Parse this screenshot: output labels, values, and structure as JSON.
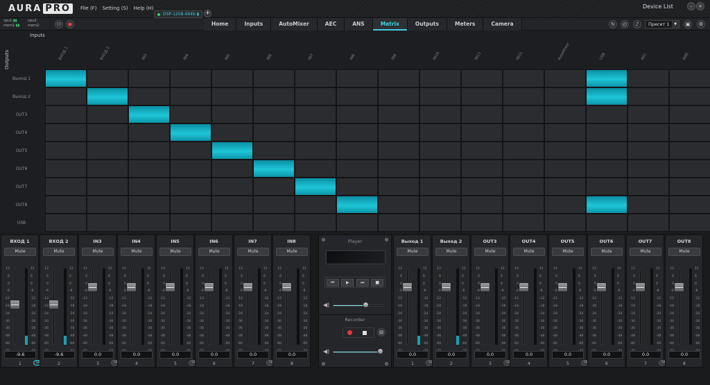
{
  "app": {
    "logo_main": "AURA",
    "logo_pro": "PRO",
    "menu": [
      "File (F)",
      "Setting (S)",
      "Help (H)"
    ],
    "device_list": "Device List"
  },
  "status": {
    "cpu1": "cpu1:",
    "mem1": "mem1:",
    "cpu2": "cpu2:",
    "mem2": "mem2:",
    "device_tab": "DSP-1208-464b"
  },
  "tabs": [
    "Home",
    "Inputs",
    "AutoMixer",
    "AEC",
    "ANS",
    "Matrix",
    "Outputs",
    "Meters",
    "Camera"
  ],
  "active_tab": "Matrix",
  "preset": "Пресет 1",
  "matrix": {
    "inputs_label": "Inputs",
    "outputs_label": "Outputs",
    "columns": [
      "ВХОД 1",
      "ВХОД 2",
      "IN3",
      "IN4",
      "IN5",
      "IN6",
      "IN7",
      "IN8",
      "IN9",
      "IN10",
      "IN11",
      "IN12",
      "AutoMixer",
      "USB",
      "AEC",
      "ANS"
    ],
    "rows": [
      "Выход 1",
      "Выход 2",
      "OUT3",
      "OUT4",
      "OUT5",
      "OUT6",
      "OUT7",
      "OUT8",
      "USB"
    ],
    "active": [
      [
        0,
        0
      ],
      [
        0,
        13
      ],
      [
        1,
        1
      ],
      [
        1,
        13
      ],
      [
        2,
        2
      ],
      [
        3,
        3
      ],
      [
        4,
        4
      ],
      [
        5,
        5
      ],
      [
        6,
        6
      ],
      [
        7,
        7
      ],
      [
        7,
        13
      ]
    ]
  },
  "mixer": {
    "mute_label": "Mute",
    "link_label": "Link",
    "scale": [
      "12",
      "6",
      "0",
      "-6",
      "-12",
      "-18",
      "-24",
      "-30",
      "-36",
      "-48",
      "-60",
      "-72"
    ],
    "inputs": [
      {
        "name": "ВХОД 1",
        "value": "-9.6",
        "num": "1",
        "level": 0.55,
        "meter": 0.12,
        "link": "on"
      },
      {
        "name": "ВХОД 2",
        "value": "-9.6",
        "num": "2",
        "level": 0.55,
        "meter": 0.12,
        "link": "none"
      },
      {
        "name": "IN3",
        "value": "0.0",
        "num": "3",
        "level": 0.8,
        "meter": 0,
        "link": "off"
      },
      {
        "name": "IN4",
        "value": "0.0",
        "num": "4",
        "level": 0.8,
        "meter": 0,
        "link": "none"
      },
      {
        "name": "IN5",
        "value": "0.0",
        "num": "5",
        "level": 0.8,
        "meter": 0,
        "link": "off"
      },
      {
        "name": "IN6",
        "value": "0.0",
        "num": "6",
        "level": 0.8,
        "meter": 0,
        "link": "none"
      },
      {
        "name": "IN7",
        "value": "0.0",
        "num": "7",
        "level": 0.8,
        "meter": 0,
        "link": "off"
      },
      {
        "name": "IN8",
        "value": "0.0",
        "num": "8",
        "level": 0.8,
        "meter": 0,
        "link": "none"
      }
    ],
    "outputs": [
      {
        "name": "Выход 1",
        "value": "0.0",
        "num": "1",
        "level": 0.8,
        "meter": 0.12,
        "link": "off"
      },
      {
        "name": "Выход 2",
        "value": "0.0",
        "num": "2",
        "level": 0.8,
        "meter": 0.12,
        "link": "none"
      },
      {
        "name": "OUT3",
        "value": "0.0",
        "num": "3",
        "level": 0.8,
        "meter": 0,
        "link": "off"
      },
      {
        "name": "OUT4",
        "value": "0.0",
        "num": "4",
        "level": 0.8,
        "meter": 0,
        "link": "none"
      },
      {
        "name": "OUT5",
        "value": "0.0",
        "num": "5",
        "level": 0.8,
        "meter": 0,
        "link": "off"
      },
      {
        "name": "OUT6",
        "value": "0.0",
        "num": "6",
        "level": 0.8,
        "meter": 0,
        "link": "none"
      },
      {
        "name": "OUT7",
        "value": "0.0",
        "num": "7",
        "level": 0.8,
        "meter": 0,
        "link": "off"
      },
      {
        "name": "OUT8",
        "value": "0.0",
        "num": "8",
        "level": 0.8,
        "meter": 0,
        "link": "none"
      }
    ]
  },
  "player": {
    "title": "Player",
    "recorder_title": "Recorder",
    "buttons": [
      "⏮",
      "▶",
      "⏭",
      "■"
    ],
    "player_volume": 0.65,
    "recorder_volume": 0.95
  },
  "colors": {
    "accent": "#1ec5d8",
    "record": "#e53838"
  }
}
